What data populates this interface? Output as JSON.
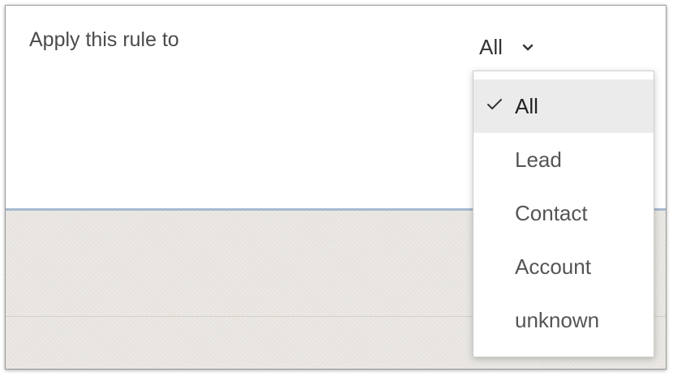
{
  "rule": {
    "label": "Apply this rule to",
    "selected_value": "All"
  },
  "dropdown": {
    "options": [
      {
        "label": "All",
        "selected": true
      },
      {
        "label": "Lead",
        "selected": false
      },
      {
        "label": "Contact",
        "selected": false
      },
      {
        "label": "Account",
        "selected": false
      },
      {
        "label": "unknown",
        "selected": false
      }
    ]
  },
  "icons": {
    "trigger": "chevron-down-icon",
    "selected_marker": "check-icon"
  },
  "colors": {
    "divider": "#a7b9cf",
    "selected_background": "#ebebeb",
    "lower_panel": "#e9e6e1"
  }
}
